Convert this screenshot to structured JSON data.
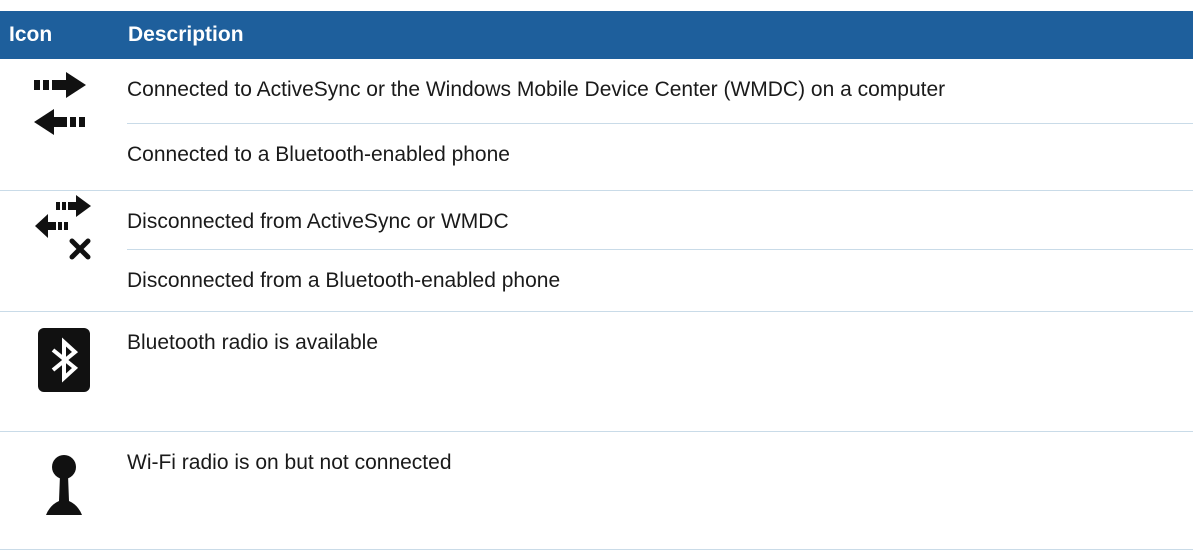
{
  "table": {
    "header": {
      "icon": "Icon",
      "description": "Description"
    },
    "rows": [
      {
        "icon": "activesync-connected-arrows-icon",
        "lines": [
          "Connected to ActiveSync or the Windows Mobile Device Center (WMDC) on a computer",
          "Connected to a Bluetooth-enabled phone"
        ]
      },
      {
        "icon": "activesync-disconnected-arrows-x-icon",
        "lines": [
          "Disconnected from ActiveSync or WMDC",
          "Disconnected from a Bluetooth-enabled phone"
        ]
      },
      {
        "icon": "bluetooth-icon",
        "lines": [
          "Bluetooth radio is available"
        ]
      },
      {
        "icon": "wifi-antenna-icon",
        "lines": [
          "Wi-Fi radio is on but not connected"
        ]
      }
    ]
  },
  "colors": {
    "header_bg": "#1e5f9c",
    "header_text": "#ffffff",
    "row_rule": "#c9dbe8",
    "text": "#1a1a1a"
  }
}
